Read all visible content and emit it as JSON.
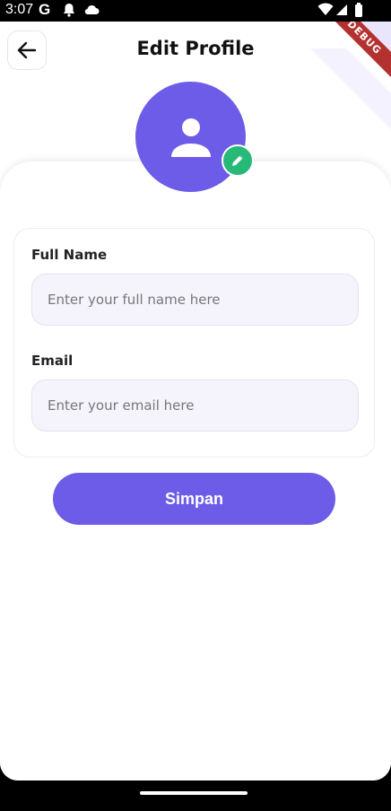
{
  "status_bar": {
    "time": "3:07",
    "g_label": "G"
  },
  "header": {
    "title": "Edit Profile",
    "debug_label": "DEBUG"
  },
  "form": {
    "full_name": {
      "label": "Full Name",
      "value": "",
      "placeholder": "Enter your full name here"
    },
    "email": {
      "label": "Email",
      "value": "",
      "placeholder": "Enter your email here"
    }
  },
  "actions": {
    "save_label": "Simpan"
  },
  "colors": {
    "primary": "#6c5ce7",
    "edit_badge": "#27b977",
    "field_bg": "#f5f4fd"
  }
}
